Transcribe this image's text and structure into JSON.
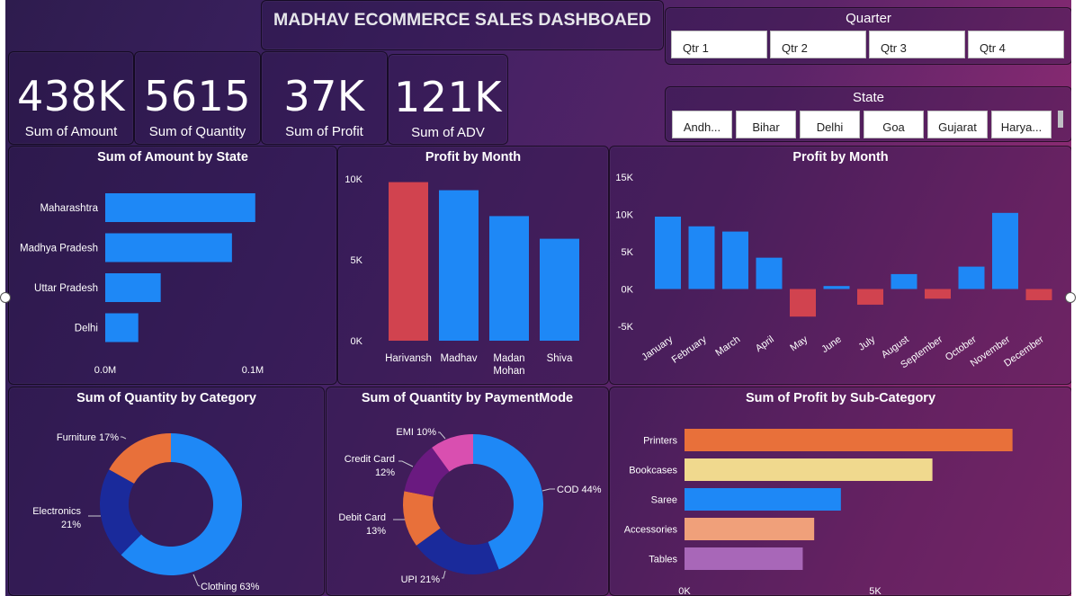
{
  "dashboard": {
    "title": "MADHAV ECOMMERCE SALES DASHBOAED"
  },
  "kpis": [
    {
      "value": "438K",
      "label": "Sum of Amount"
    },
    {
      "value": "5615",
      "label": "Sum of Quantity"
    },
    {
      "value": "37K",
      "label": "Sum of Profit"
    },
    {
      "value": "121K",
      "label": "Sum of ADV"
    }
  ],
  "quarter_slicer": {
    "title": "Quarter",
    "items": [
      "Qtr 1",
      "Qtr 2",
      "Qtr 3",
      "Qtr 4"
    ]
  },
  "state_slicer": {
    "title": "State",
    "items": [
      "Andh...",
      "Bihar",
      "Delhi",
      "Goa",
      "Gujarat",
      "Harya..."
    ]
  },
  "colors": {
    "blue": "#1e88f6",
    "red": "#d1434f",
    "donut_blue": "#1e88f6",
    "donut_navy": "#1a2a9b",
    "donut_orange": "#e8703a",
    "donut_purple": "#6a1a80",
    "donut_pink": "#d94fb0",
    "printers": "#e8703a",
    "bookcases": "#f0d98e",
    "saree": "#1e88f6",
    "accessories": "#f0a07a",
    "tables": "#a867b8"
  },
  "chart_data": [
    {
      "id": "amount_by_state",
      "type": "bar",
      "orientation": "horizontal",
      "title": "Sum of Amount by State",
      "categories": [
        "Maharashtra",
        "Madhya Pradesh",
        "Uttar Pradesh",
        "Delhi"
      ],
      "values": [
        0.1017,
        0.0859,
        0.0376,
        0.0224
      ],
      "xlim": [
        0,
        0.1
      ],
      "xticks": [
        "0.0M",
        "0.1M"
      ]
    },
    {
      "id": "profit_by_customer",
      "type": "bar",
      "title": "Profit by Month",
      "categories": [
        "Harivansh",
        "Madhav",
        "Madan Mohan",
        "Shiva"
      ],
      "values": [
        9800,
        9300,
        7700,
        6300
      ],
      "highlight": [
        true,
        false,
        false,
        false
      ],
      "ylim": [
        0,
        10000
      ],
      "yticks": [
        "0K",
        "5K",
        "10K"
      ]
    },
    {
      "id": "profit_by_month",
      "type": "bar",
      "title": "Profit by Month",
      "categories": [
        "January",
        "February",
        "March",
        "April",
        "May",
        "June",
        "July",
        "August",
        "September",
        "October",
        "November",
        "December"
      ],
      "values": [
        9700,
        8400,
        7700,
        4200,
        -3700,
        400,
        -2100,
        2000,
        -1300,
        3000,
        10200,
        -1500
      ],
      "ylim": [
        -5000,
        15000
      ],
      "yticks": [
        "-5K",
        "0K",
        "5K",
        "10K",
        "15K"
      ]
    },
    {
      "id": "qty_by_category",
      "type": "pie",
      "donut": true,
      "title": "Sum of Quantity by Category",
      "slices": [
        {
          "name": "Clothing",
          "value": 63,
          "label": "Clothing 63%"
        },
        {
          "name": "Electronics",
          "value": 21,
          "label_lines": [
            "Electronics",
            "21%"
          ]
        },
        {
          "name": "Furniture",
          "value": 17,
          "label": "Furniture 17%"
        }
      ]
    },
    {
      "id": "qty_by_paymentmode",
      "type": "pie",
      "donut": true,
      "title": "Sum of Quantity by PaymentMode",
      "slices": [
        {
          "name": "COD",
          "value": 44,
          "label": "COD 44%"
        },
        {
          "name": "UPI",
          "value": 21,
          "label": "UPI 21%"
        },
        {
          "name": "Debit Card",
          "value": 13,
          "label_lines": [
            "Debit Card",
            "13%"
          ]
        },
        {
          "name": "Credit Card",
          "value": 12,
          "label_lines": [
            "Credit Card",
            "12%"
          ]
        },
        {
          "name": "EMI",
          "value": 10,
          "label": "EMI 10%"
        }
      ]
    },
    {
      "id": "profit_by_subcategory",
      "type": "bar",
      "orientation": "horizontal",
      "title": "Sum of Profit by Sub-Category",
      "categories": [
        "Printers",
        "Bookcases",
        "Saree",
        "Accessories",
        "Tables"
      ],
      "values": [
        8600,
        6500,
        4100,
        3400,
        3100
      ],
      "xlim": [
        0,
        5000
      ],
      "xticks": [
        "0K",
        "5K"
      ]
    }
  ]
}
